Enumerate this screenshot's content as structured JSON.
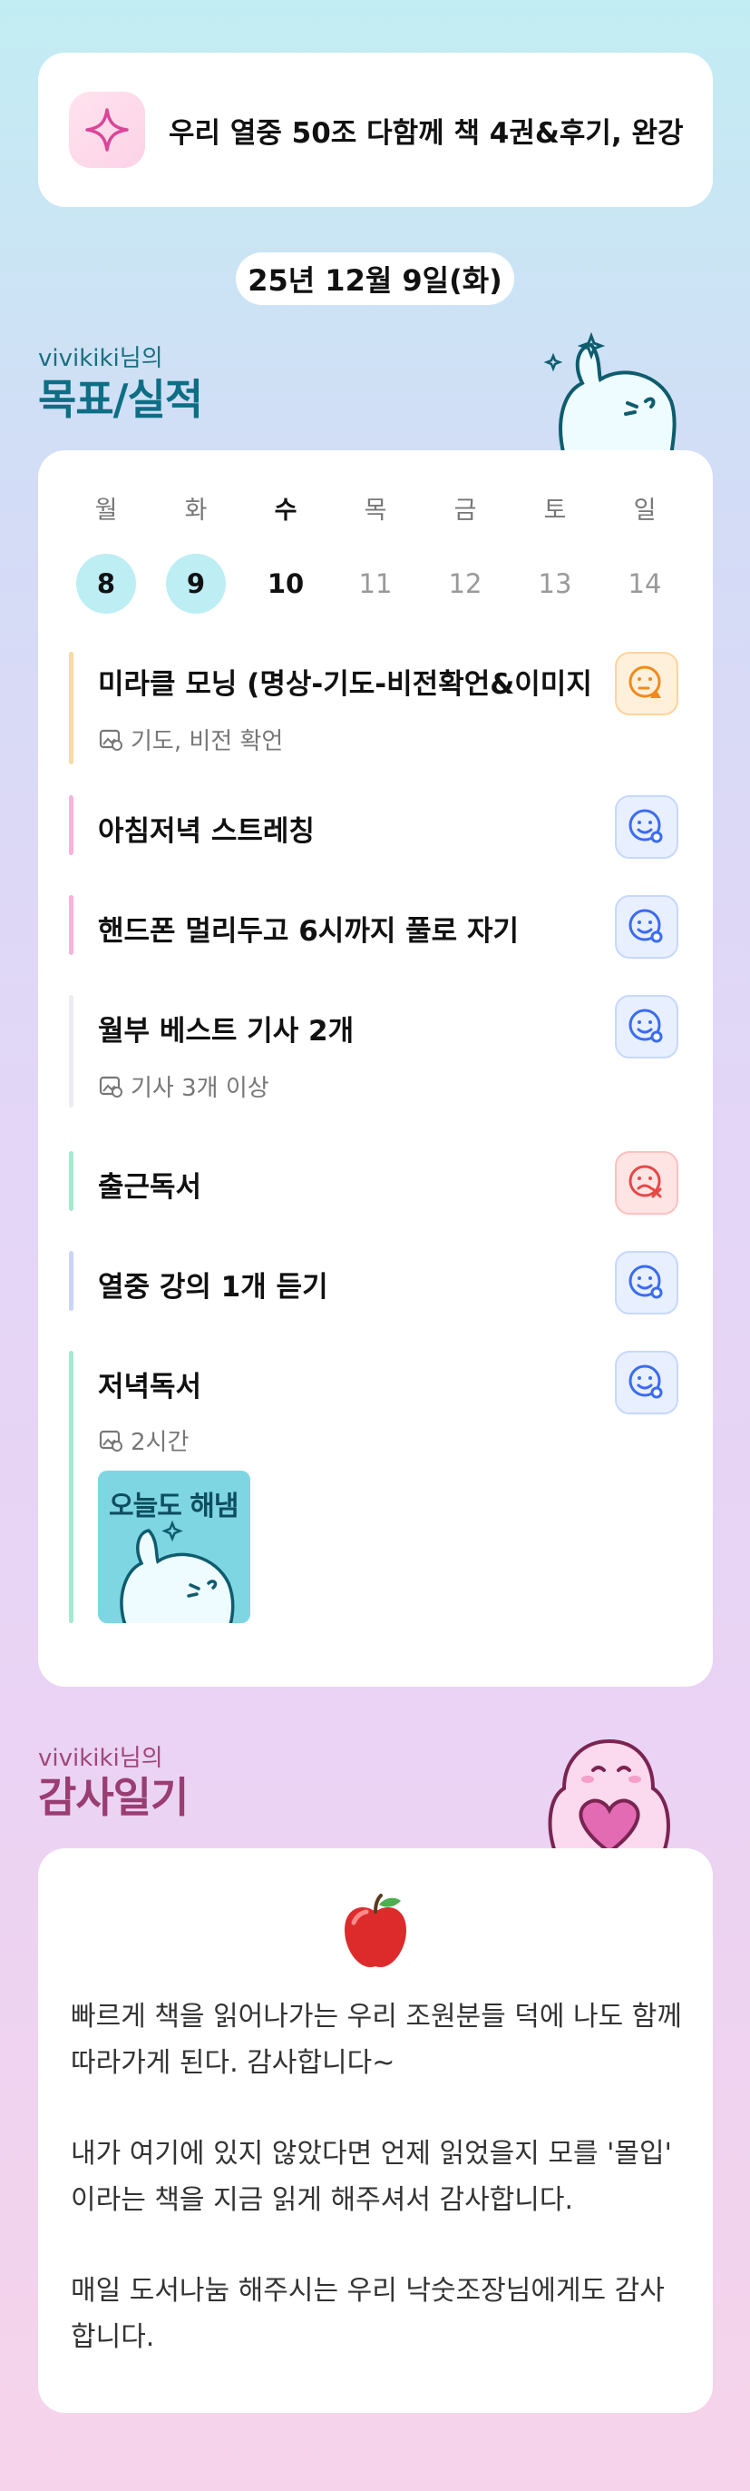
{
  "banner": {
    "text": "우리 열중 50조 다함께 책 4권&후기, 완강",
    "icon": "sparkle-icon"
  },
  "date": "25년 12월 9일(화)",
  "goals_section": {
    "user": "vivikiki님의",
    "title": "목표/실적"
  },
  "calendar": {
    "weekdays": [
      "월",
      "화",
      "수",
      "목",
      "금",
      "토",
      "일"
    ],
    "dates": [
      "8",
      "9",
      "10",
      "11",
      "12",
      "13",
      "14"
    ]
  },
  "goals": [
    {
      "title": "미라클 모닝 (명상-기도-비전확언&이미지",
      "sub": "기도, 비전 확언",
      "status": "partial",
      "color": "#f7dca0"
    },
    {
      "title": "아침저녁 스트레칭",
      "sub": "",
      "status": "scheduled",
      "color": "#f7b3dc"
    },
    {
      "title": "핸드폰 멀리두고 6시까지 풀로 자기",
      "sub": "",
      "status": "scheduled",
      "color": "#f7b3dc"
    },
    {
      "title": "월부 베스트 기사 2개",
      "sub": "기사 3개 이상",
      "status": "scheduled",
      "color": "#ececf3"
    },
    {
      "title": "출근독서",
      "sub": "",
      "status": "failed",
      "color": "#a7e8cf"
    },
    {
      "title": "열중 강의 1개 듣기",
      "sub": "",
      "status": "scheduled",
      "color": "#c9d5f7"
    },
    {
      "title": "저녁독서",
      "sub": "2시간",
      "status": "scheduled",
      "color": "#a7e8cf",
      "photo_text": "오늘도 해냄"
    }
  ],
  "gratitude_section": {
    "user": "vivikiki님의",
    "title": "감사일기"
  },
  "gratitude": {
    "icon": "apple-icon",
    "paragraphs": [
      "빠르게 책을 읽어나가는 우리 조원분들 덕에 나도 함께 따라가게 된다. 감사합니다~",
      "내가 여기에 있지 않았다면 언제 읽었을지 모를 '몰입' 이라는 책을 지금 읽게 해주셔서 감사합니다.",
      "매일 도서나눔 해주시는 우리 낙숫조장님에게도 감사합니다."
    ]
  }
}
